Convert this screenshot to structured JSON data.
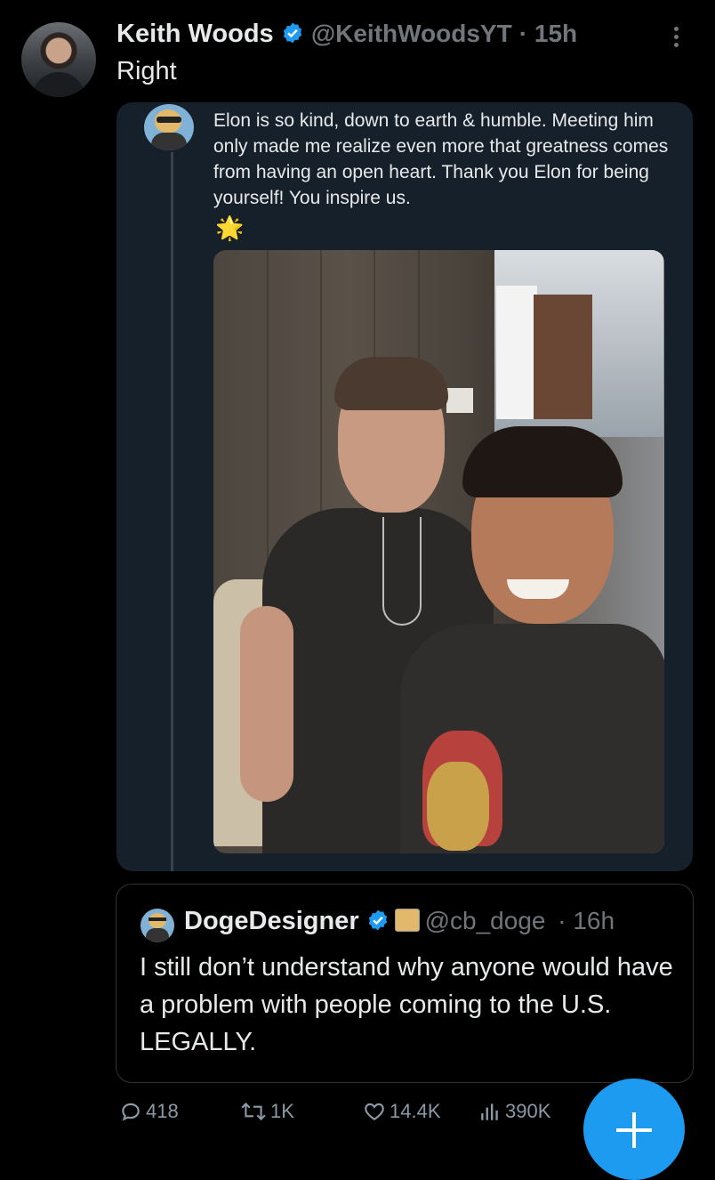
{
  "post": {
    "author_name": "Keith Woods",
    "handle": "@KeithWoodsYT",
    "time": "15h",
    "text": "Right"
  },
  "embedded": {
    "text": "Elon is so kind, down to earth & humble. Meeting him only made me realize even more that greatness comes from having an open heart. Thank you Elon for being yourself! You inspire us.",
    "emoji": "🌟"
  },
  "quote": {
    "author_name": "DogeDesigner",
    "handle": "@cb_doge",
    "time": "16h",
    "text": "I still don’t understand why anyone would have a problem with people coming to the U.S. LEGALLY."
  },
  "actions": {
    "replies": "418",
    "reposts": "1K",
    "likes": "14.4K",
    "views": "390K"
  },
  "colors": {
    "background": "#000000",
    "card": "#15202b",
    "accent": "#1d9bf0",
    "muted": "#71767b",
    "text": "#e7e9ea"
  },
  "icons": [
    "verified-badge-icon",
    "more-icon",
    "reply-icon",
    "repost-icon",
    "like-icon",
    "views-icon",
    "compose-icon"
  ]
}
